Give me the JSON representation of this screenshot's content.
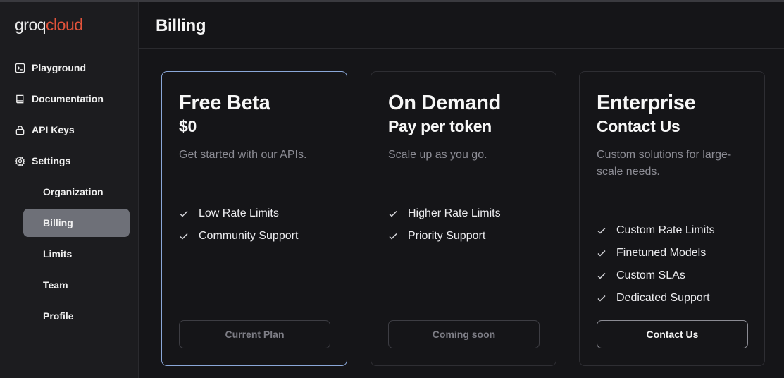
{
  "logo": {
    "part1": "groq",
    "part2": "cloud"
  },
  "sidebar": {
    "items": [
      {
        "label": "Playground",
        "icon": "terminal-icon"
      },
      {
        "label": "Documentation",
        "icon": "book-icon"
      },
      {
        "label": "API Keys",
        "icon": "lock-icon"
      },
      {
        "label": "Settings",
        "icon": "gear-icon"
      }
    ],
    "subitems": [
      {
        "label": "Organization",
        "active": false
      },
      {
        "label": "Billing",
        "active": true
      },
      {
        "label": "Limits",
        "active": false
      },
      {
        "label": "Team",
        "active": false
      },
      {
        "label": "Profile",
        "active": false
      }
    ]
  },
  "header": {
    "title": "Billing"
  },
  "plans": [
    {
      "title": "Free Beta",
      "price": "$0",
      "description": "Get started with our APIs.",
      "features": [
        "Low Rate Limits",
        "Community Support"
      ],
      "button": "Current Plan",
      "selected": true
    },
    {
      "title": "On Demand",
      "price": "Pay per token",
      "description": "Scale up as you go.",
      "features": [
        "Higher Rate Limits",
        "Priority Support"
      ],
      "button": "Coming soon",
      "selected": false
    },
    {
      "title": "Enterprise",
      "price": "Contact Us",
      "description": "Custom solutions for large-scale needs.",
      "features": [
        "Custom Rate Limits",
        "Finetuned Models",
        "Custom SLAs",
        "Dedicated Support"
      ],
      "button": "Contact Us",
      "selected": false
    }
  ],
  "colors": {
    "accent": "#e2533b",
    "selected_border": "#8aa7d8",
    "active_nav": "#6e7078"
  }
}
